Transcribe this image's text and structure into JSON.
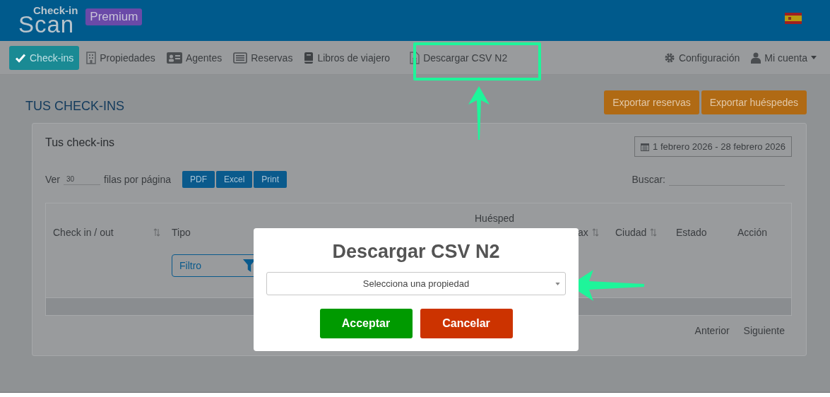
{
  "header": {
    "logo_top": "Check-in",
    "logo_bottom": "Scan",
    "badge": "Premium"
  },
  "nav": {
    "items": [
      {
        "label": "Check-ins",
        "selected": true
      },
      {
        "label": "Propiedades",
        "selected": false
      },
      {
        "label": "Agentes",
        "selected": false
      },
      {
        "label": "Reservas",
        "selected": false
      },
      {
        "label": "Libros de viajero",
        "selected": false
      },
      {
        "label": "Descargar CSV N2",
        "selected": false
      }
    ],
    "right": [
      {
        "label": "Configuración"
      },
      {
        "label": "Mi cuenta"
      }
    ]
  },
  "page": {
    "title": "TUS CHECK-INS",
    "buttons": [
      "Exportar reservas",
      "Exportar huéspedes"
    ]
  },
  "card": {
    "title": "Tus check-ins",
    "date_range": "1 febrero 2026 - 28 febrero 2026",
    "show_label": "Ver",
    "page_size": "30",
    "per_page_label": "filas por página",
    "export_buttons": [
      "PDF",
      "Excel",
      "Print"
    ],
    "search_label": "Buscar:",
    "table": {
      "group_heading": "Huésped",
      "columns": [
        {
          "label": "Check in / out",
          "sortable": true
        },
        {
          "label": "Tipo",
          "sortable": false
        },
        {
          "label": "ax",
          "sortable": true
        },
        {
          "label": "Ciudad",
          "sortable": true
        },
        {
          "label": "Estado",
          "sortable": false
        },
        {
          "label": "Acción",
          "sortable": false
        }
      ],
      "filter": {
        "placeholder": "Filtro"
      }
    },
    "pagination": [
      "Anterior",
      "Siguiente"
    ]
  },
  "modal": {
    "title": "Descargar CSV N2",
    "select": {
      "placeholder": "Selecciona una propiedad"
    },
    "buttons": [
      {
        "label": "Acceptar",
        "kind": "confirm"
      },
      {
        "label": "Cancelar",
        "kind": "cancel"
      }
    ]
  }
}
